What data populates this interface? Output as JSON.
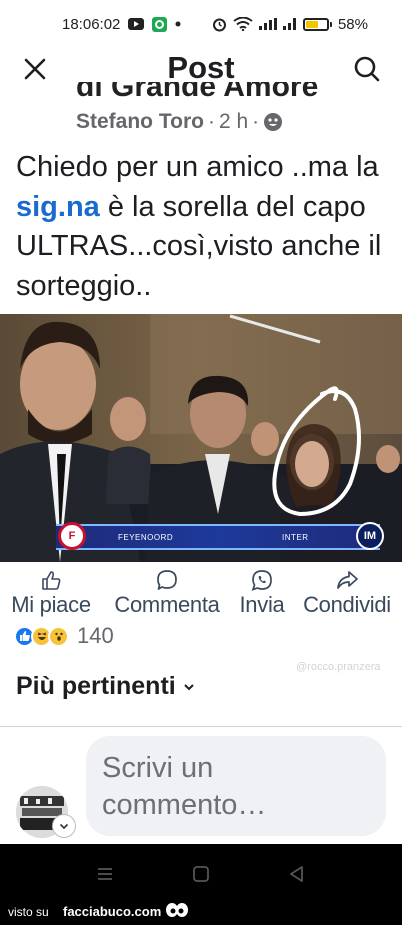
{
  "status": {
    "time": "18:06:02",
    "battery": "58%",
    "battery_level": 0.58
  },
  "header": {
    "title": "Post"
  },
  "post": {
    "cut_title": "di Grande Amore",
    "author": "Stefano Toro",
    "time_ago": "2 h",
    "separator": "·",
    "text_part1": "Chiedo per un amico ..ma la ",
    "text_link": "sig.na",
    "text_part2": " è la sorella del capo ULTRAS...così,visto anche il sorteggio..",
    "video": {
      "team_home": "FEYENOORD",
      "team_away": "INTER"
    }
  },
  "actions": [
    {
      "label": "Mi piace",
      "icon": "like-icon"
    },
    {
      "label": "Commenta",
      "icon": "comment-icon"
    },
    {
      "label": "Invia",
      "icon": "whatsapp-icon"
    },
    {
      "label": "Condividi",
      "icon": "share-icon"
    }
  ],
  "reactions": {
    "count": "140",
    "icons": [
      "like-reaction-icon",
      "haha-reaction-icon",
      "wow-reaction-icon"
    ]
  },
  "watermark": "@rocco.pranzera",
  "comments": {
    "sort_label": "Più pertinenti",
    "input_placeholder": "Scrivi un commento…"
  },
  "footer": {
    "visto_su": "visto su",
    "brand": "facciabuco.com"
  },
  "colors": {
    "accent_link": "#1a6ad0",
    "like_blue": "#1877f2",
    "haha_yellow": "#f7c33a"
  }
}
